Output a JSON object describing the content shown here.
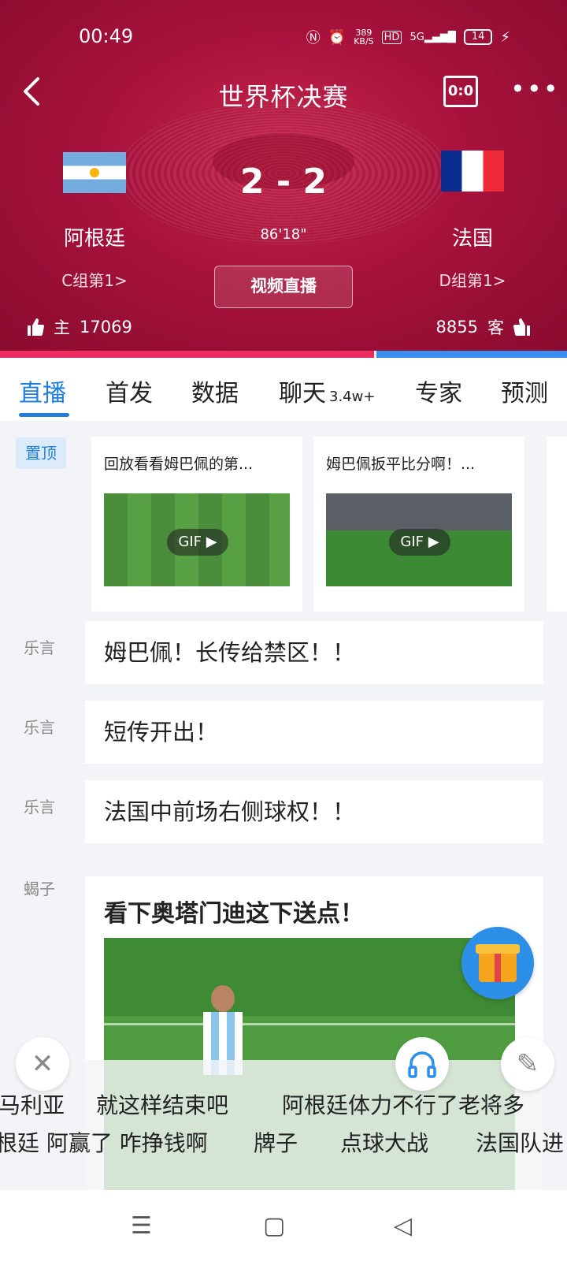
{
  "status": {
    "time": "00:49",
    "net_speed_top": "389",
    "net_speed_bottom": "KB/S",
    "hd": "HD",
    "signal": "5G",
    "battery": "14"
  },
  "header": {
    "title": "世界杯决赛",
    "score_icon": "0:0"
  },
  "match": {
    "home": {
      "name": "阿根廷",
      "group": "C组第1>",
      "votes_label": "主",
      "votes": "17069"
    },
    "away": {
      "name": "法国",
      "group": "D组第1>",
      "votes_label": "客",
      "votes": "8855"
    },
    "score": "2 - 2",
    "time": "86'18\"",
    "video_button": "视频直播",
    "home_vote_share": 0.66
  },
  "tabs": [
    {
      "label": "直播"
    },
    {
      "label": "首发"
    },
    {
      "label": "数据"
    },
    {
      "label": "聊天",
      "badge": "3.4w+"
    },
    {
      "label": "专家"
    },
    {
      "label": "预测"
    }
  ],
  "pinned": {
    "tag": "置顶",
    "cards": [
      {
        "title": "回放看看姆巴佩的第...",
        "badge": "GIF ▶"
      },
      {
        "title": "姆巴佩扳平比分啊！...",
        "badge": "GIF ▶"
      }
    ]
  },
  "messages": [
    {
      "author": "乐言",
      "text": "姆巴佩！长传给禁区！！"
    },
    {
      "author": "乐言",
      "text": "短传开出！"
    },
    {
      "author": "乐言",
      "text": "法国中前场右侧球权！！"
    }
  ],
  "big_post": {
    "author": "蝎子",
    "title": "看下奥塔门迪这下送点！"
  },
  "danmu": {
    "row1": [
      "马利亚",
      "就这样结束吧",
      "阿根廷体力不行了老将多"
    ],
    "row2": [
      "根廷 阿赢了 咋挣钱啊",
      "牌子",
      "点球大战",
      "法国队进"
    ]
  },
  "colors": {
    "accent": "#1f7fdb",
    "header": "#a8123c",
    "home_bar": "#ee2c62",
    "away_bar": "#3a8ef0"
  }
}
